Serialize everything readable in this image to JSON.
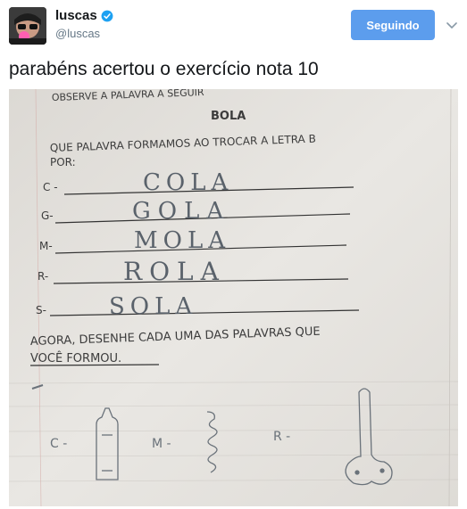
{
  "user": {
    "display_name": "luscas",
    "handle": "@luscas"
  },
  "follow_button_label": "Seguindo",
  "tweet_text": "parabéns acertou o exercício nota 10",
  "worksheet": {
    "header_text": "OBSERVE A PALAVRA A SEGUIR",
    "word": "BOLA",
    "question": "QUE PALAVRA FORMAMOS AO TROCAR A LETRA B",
    "question_cont": "POR:",
    "rows": [
      {
        "letter": "C -",
        "answer": "COLA"
      },
      {
        "letter": "G-",
        "answer": "GOLA"
      },
      {
        "letter": "M-",
        "answer": "MOLA"
      },
      {
        "letter": "R-",
        "answer": "ROLA"
      },
      {
        "letter": "S-",
        "answer": "SOLA"
      }
    ],
    "draw_prompt": "AGORA, DESENHE CADA UMA DAS PALAVRAS QUE",
    "draw_prompt_cont": "VOCÊ FORMOU.",
    "drawing_labels": [
      "C -",
      "M -",
      "R -"
    ]
  },
  "colors": {
    "button_bg": "#5c9ded",
    "verified": "#1da1f2",
    "handle": "#657786"
  }
}
